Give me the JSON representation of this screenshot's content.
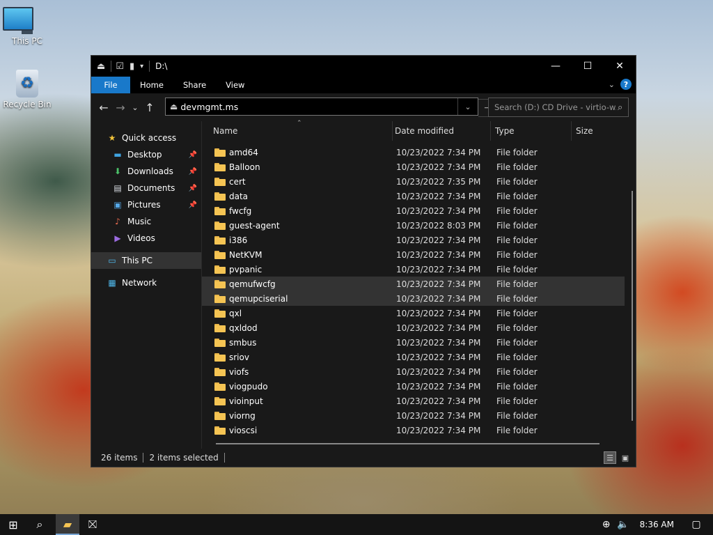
{
  "desktop": {
    "icons": [
      {
        "label": "This PC"
      },
      {
        "label": "Recycle Bin"
      }
    ]
  },
  "window": {
    "title": "D:\\",
    "controls": {
      "minimize": "—",
      "maximize": "☐",
      "close": "✕"
    }
  },
  "ribbon": {
    "tabs": [
      "File",
      "Home",
      "Share",
      "View"
    ],
    "help": "?"
  },
  "address": {
    "value": "devmgmt.ms"
  },
  "search": {
    "placeholder": "Search (D:) CD Drive - virtio-w..."
  },
  "nav_pane": {
    "quick_access": "Quick access",
    "quick_items": [
      "Desktop",
      "Downloads",
      "Documents",
      "Pictures",
      "Music",
      "Videos"
    ],
    "this_pc": "This PC",
    "network": "Network"
  },
  "columns": {
    "name": "Name",
    "date": "Date modified",
    "type": "Type",
    "size": "Size"
  },
  "files": [
    {
      "name": "amd64",
      "date": "10/23/2022 7:34 PM",
      "type": "File folder",
      "selected": false
    },
    {
      "name": "Balloon",
      "date": "10/23/2022 7:34 PM",
      "type": "File folder",
      "selected": false
    },
    {
      "name": "cert",
      "date": "10/23/2022 7:35 PM",
      "type": "File folder",
      "selected": false
    },
    {
      "name": "data",
      "date": "10/23/2022 7:34 PM",
      "type": "File folder",
      "selected": false
    },
    {
      "name": "fwcfg",
      "date": "10/23/2022 7:34 PM",
      "type": "File folder",
      "selected": false
    },
    {
      "name": "guest-agent",
      "date": "10/23/2022 8:03 PM",
      "type": "File folder",
      "selected": false
    },
    {
      "name": "i386",
      "date": "10/23/2022 7:34 PM",
      "type": "File folder",
      "selected": false
    },
    {
      "name": "NetKVM",
      "date": "10/23/2022 7:34 PM",
      "type": "File folder",
      "selected": false
    },
    {
      "name": "pvpanic",
      "date": "10/23/2022 7:34 PM",
      "type": "File folder",
      "selected": false
    },
    {
      "name": "qemufwcfg",
      "date": "10/23/2022 7:34 PM",
      "type": "File folder",
      "selected": true
    },
    {
      "name": "qemupciserial",
      "date": "10/23/2022 7:34 PM",
      "type": "File folder",
      "selected": true
    },
    {
      "name": "qxl",
      "date": "10/23/2022 7:34 PM",
      "type": "File folder",
      "selected": false
    },
    {
      "name": "qxldod",
      "date": "10/23/2022 7:34 PM",
      "type": "File folder",
      "selected": false
    },
    {
      "name": "smbus",
      "date": "10/23/2022 7:34 PM",
      "type": "File folder",
      "selected": false
    },
    {
      "name": "sriov",
      "date": "10/23/2022 7:34 PM",
      "type": "File folder",
      "selected": false
    },
    {
      "name": "viofs",
      "date": "10/23/2022 7:34 PM",
      "type": "File folder",
      "selected": false
    },
    {
      "name": "viogpudo",
      "date": "10/23/2022 7:34 PM",
      "type": "File folder",
      "selected": false
    },
    {
      "name": "vioinput",
      "date": "10/23/2022 7:34 PM",
      "type": "File folder",
      "selected": false
    },
    {
      "name": "viorng",
      "date": "10/23/2022 7:34 PM",
      "type": "File folder",
      "selected": false
    },
    {
      "name": "vioscsi",
      "date": "10/23/2022 7:34 PM",
      "type": "File folder",
      "selected": false
    }
  ],
  "status": {
    "count": "26 items",
    "selected": "2 items selected"
  },
  "taskbar": {
    "clock": "8:36 AM"
  },
  "colors": {
    "accent": "#1979ca",
    "folder": "#f5c453",
    "window_bg": "#191919"
  }
}
